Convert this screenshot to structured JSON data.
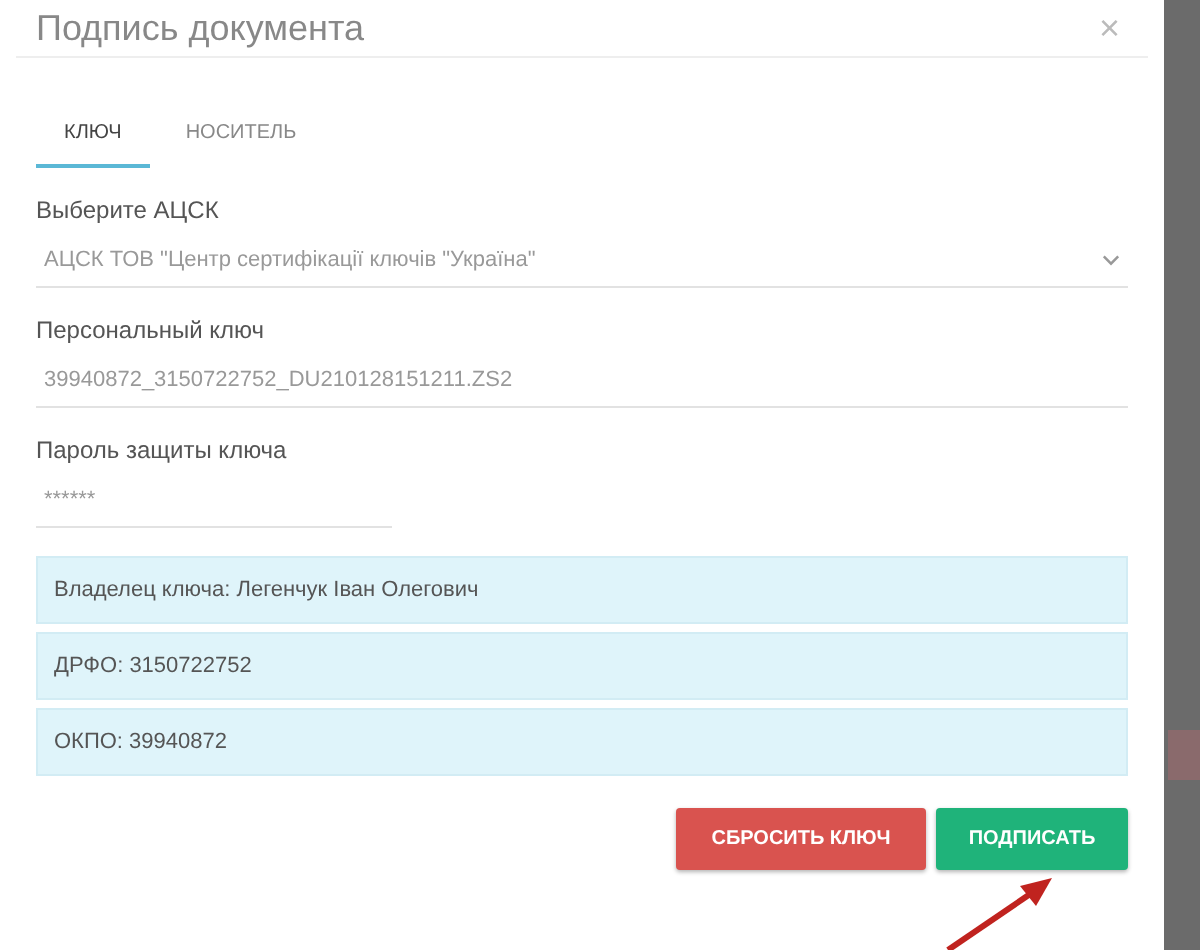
{
  "dialog": {
    "title": "Подпись документа",
    "close": "×"
  },
  "tabs": [
    {
      "label": "КЛЮЧ",
      "selected": true
    },
    {
      "label": "НОСИТЕЛЬ",
      "selected": false
    }
  ],
  "fields": [
    {
      "kind": "select",
      "label": "Выберите АЦСК",
      "value": "АЦСК ТОВ \"Центр сертифікації ключів \"Україна\""
    },
    {
      "kind": "text",
      "label": "Персональный ключ",
      "value": "39940872_3150722752_DU210128151211.ZS2"
    },
    {
      "kind": "password",
      "label": "Пароль защиты ключа",
      "value": "******"
    }
  ],
  "info": [
    "Владелец ключа: Легенчук Іван Олегович",
    "ДРФО: 3150722752",
    "ОКПО: 39940872"
  ],
  "buttons": [
    {
      "kind": "danger",
      "label": "СБРОСИТЬ КЛЮЧ"
    },
    {
      "kind": "success",
      "label": "ПОДПИСАТЬ"
    }
  ]
}
